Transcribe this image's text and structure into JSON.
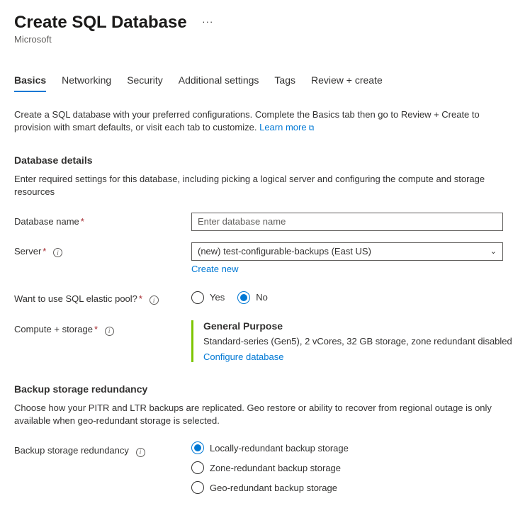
{
  "header": {
    "title": "Create SQL Database",
    "subtitle": "Microsoft",
    "more_dots": "···"
  },
  "tabs": [
    {
      "label": "Basics",
      "selected": true
    },
    {
      "label": "Networking",
      "selected": false
    },
    {
      "label": "Security",
      "selected": false
    },
    {
      "label": "Additional settings",
      "selected": false
    },
    {
      "label": "Tags",
      "selected": false
    },
    {
      "label": "Review + create",
      "selected": false
    }
  ],
  "intro": {
    "text": "Create a SQL database with your preferred configurations. Complete the Basics tab then go to Review + Create to provision with smart defaults, or visit each tab to customize. ",
    "link": "Learn more"
  },
  "database_details": {
    "title": "Database details",
    "desc": "Enter required settings for this database, including picking a logical server and configuring the compute and storage resources",
    "database_name_label": "Database name",
    "database_name_placeholder": "Enter database name",
    "database_name_value": "",
    "server_label": "Server",
    "server_value": "(new) test-configurable-backups (East US)",
    "create_new": "Create new",
    "elastic_label": "Want to use SQL elastic pool?",
    "elastic_options": {
      "yes": "Yes",
      "no": "No",
      "selected": "no"
    },
    "compute_label": "Compute + storage",
    "compute_title": "General Purpose",
    "compute_desc": "Standard-series (Gen5), 2 vCores, 32 GB storage, zone redundant disabled",
    "configure_db": "Configure database"
  },
  "backup": {
    "title": "Backup storage redundancy",
    "desc": "Choose how your PITR and LTR backups are replicated. Geo restore or ability to recover from regional outage is only available when geo-redundant storage is selected.",
    "label": "Backup storage redundancy",
    "options": [
      {
        "label": "Locally-redundant backup storage",
        "selected": true
      },
      {
        "label": "Zone-redundant backup storage",
        "selected": false
      },
      {
        "label": "Geo-redundant backup storage",
        "selected": false
      }
    ]
  }
}
